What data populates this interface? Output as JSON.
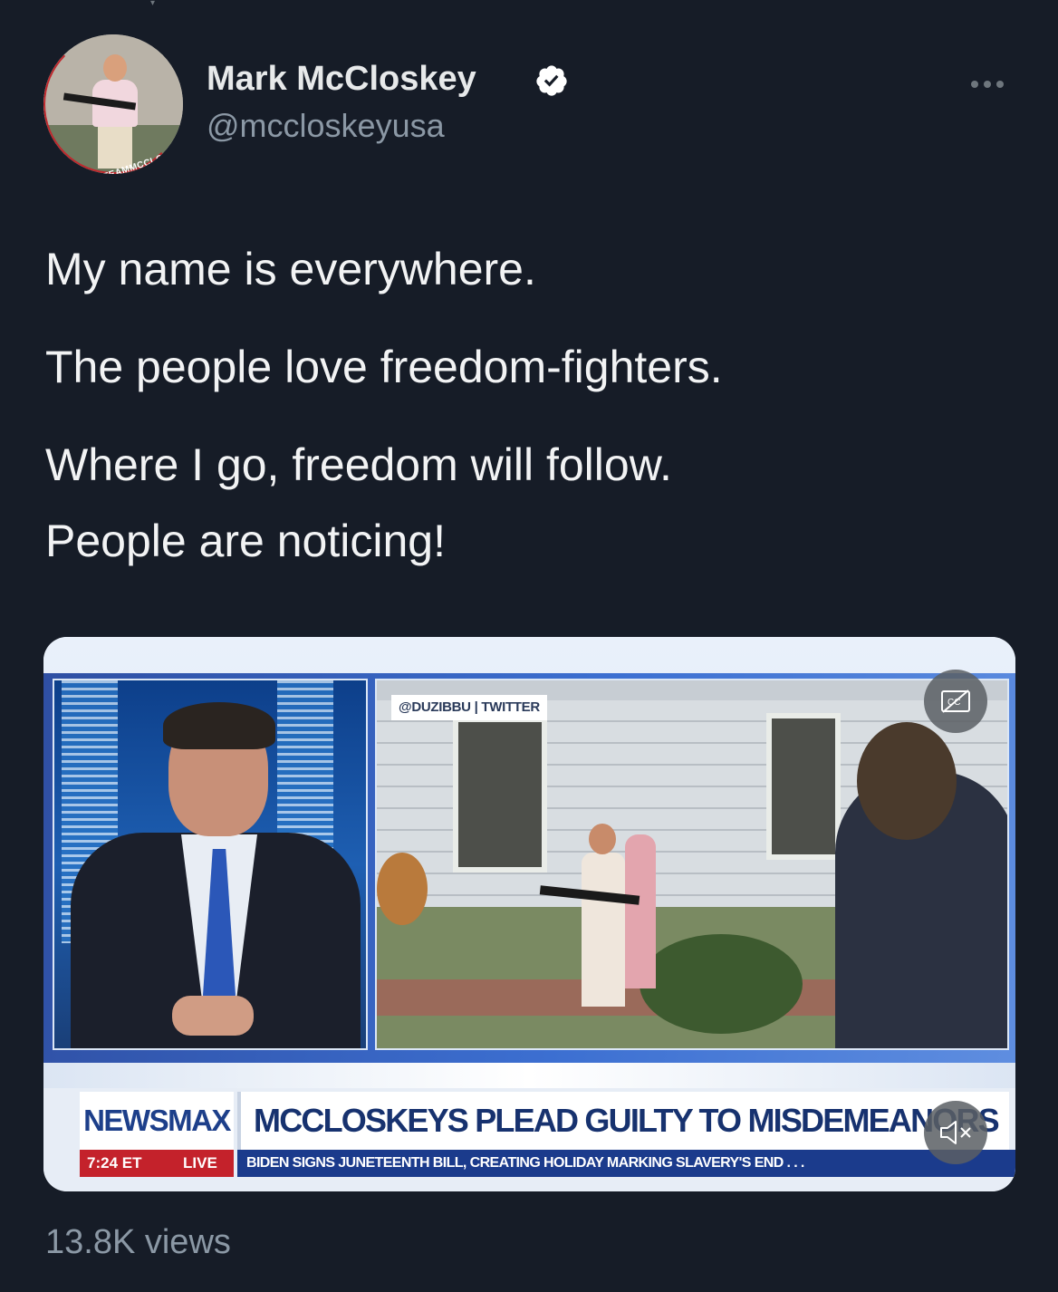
{
  "author": {
    "display_name": "Mark McCloskey",
    "handle": "@mccloskeyusa",
    "verified": true,
    "avatar_caption": "#TEAMMCCLOSKEY"
  },
  "tweet": {
    "paragraphs": [
      "My name is everywhere.",
      "The people love freedom-fighters.",
      "Where I go, freedom will follow.",
      "People are noticing!"
    ],
    "views": "13.8K views"
  },
  "video": {
    "source_tag": "@DUZIBBU | TWITTER",
    "brand": "NEWSMAX",
    "headline": "MCCLOSKEYS PLEAD GUILTY TO MISDEMEANORS",
    "time": "7:24 ET",
    "live_label": "LIVE",
    "ticker": "BIDEN SIGNS JUNETEENTH BILL, CREATING HOLIDAY MARKING SLAVERY'S END . . .",
    "captions_icon": "cc-icon",
    "mute_icon": "speaker-muted-icon"
  },
  "colors": {
    "background": "#161c27",
    "text_primary": "#e7e9ea",
    "text_secondary": "#8b98a5",
    "verified_badge": "#ffffff",
    "newsmax_red": "#c4222b",
    "newsmax_blue": "#1b3b8c"
  }
}
